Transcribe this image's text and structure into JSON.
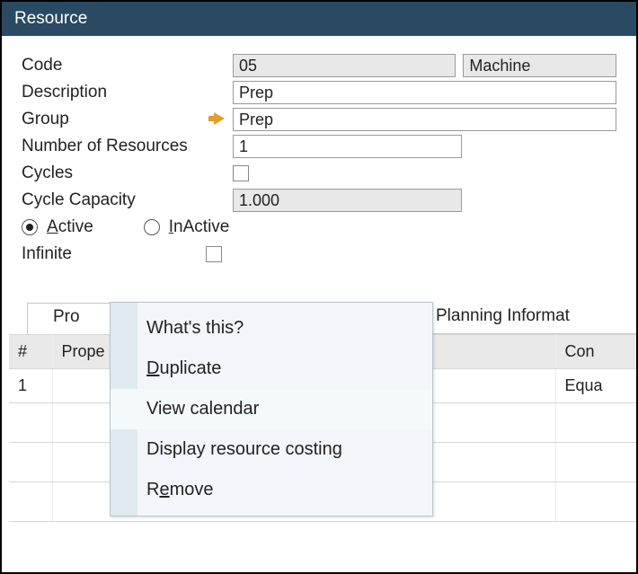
{
  "window_title": "Resource",
  "form": {
    "code_label": "Code",
    "code_value": "05",
    "type_value": "Machine",
    "description_label": "Description",
    "description_value": "Prep",
    "group_label": "Group",
    "group_value": "Prep",
    "num_resources_label": "Number of Resources",
    "num_resources_value": "1",
    "cycles_label": "Cycles",
    "cycles_checked": false,
    "cycle_capacity_label": "Cycle Capacity",
    "cycle_capacity_value": "1.000",
    "active_label": "Active",
    "inactive_label": "InActive",
    "status_selected": "active",
    "infinite_label": "Infinite",
    "infinite_checked": false
  },
  "tabs": {
    "tab1_label": "Pro",
    "tab2_label": "Planning Informat"
  },
  "table": {
    "col_num": "#",
    "col_prop": "Prope",
    "col_cond": "Con",
    "rows": [
      {
        "num": "1",
        "prop": "",
        "cond": "Equa"
      }
    ]
  },
  "context_menu": {
    "items": [
      {
        "label": "What's this?",
        "u": -1
      },
      {
        "label": "Duplicate",
        "u": 0
      },
      {
        "label": "View calendar",
        "u": -1,
        "highlight": true
      },
      {
        "label": "Display resource costing",
        "u": -1
      },
      {
        "label": "Remove",
        "u": 1
      }
    ]
  }
}
